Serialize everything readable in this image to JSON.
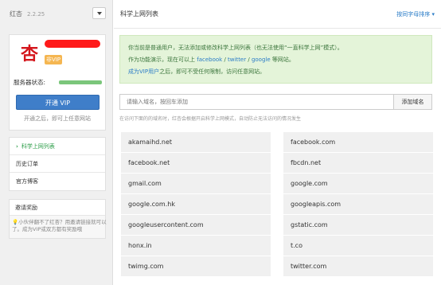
{
  "app": {
    "name": "红杏",
    "version": "2.2.25"
  },
  "user": {
    "avatar_char": "杏",
    "badge": "非VIP",
    "server_status_label": "服务器状态:",
    "server_status_level": 1.0,
    "vip_button": "开通 VIP",
    "vip_note": "开通之后，即可上任意网站"
  },
  "nav": {
    "items": [
      {
        "label": "科学上网列表",
        "active": true
      },
      {
        "label": "历史订单",
        "active": false
      },
      {
        "label": "官方博客",
        "active": false
      }
    ]
  },
  "invite": {
    "title": "邀请奖励",
    "text": "小伙伴翻不了红杏？用邀请链接就可以了。成为VIP或双方都有奖励哦"
  },
  "main": {
    "title": "科学上网列表",
    "sort_link": "按同字母排序 ▾",
    "notice": {
      "line1": "你当前是普通用户，无法添加或修改科学上网列表（也无法使用“一直科学上网”模式）。",
      "line2_pre": "作为功能演示，现在可以上",
      "line2_sites": [
        "facebook",
        "twitter",
        "google"
      ],
      "line2_post": "等网站。",
      "line3_link": "成为VIP用户",
      "line3_post": "之后，即可不受任何限制，访问任意网站。"
    },
    "search": {
      "placeholder": "请输入域名，按回车添加",
      "add_label": "添加域名"
    },
    "hint": "在访问下面的的域名时，红杏会根据开启科学上网模式，自动防止无法访问的情况发生"
  },
  "domains_left": [
    "akamaihd.net",
    "facebook.net",
    "gmail.com",
    "google.com.hk",
    "googleusercontent.com",
    "honx.in",
    "twimg.com"
  ],
  "domains_right": [
    "facebook.com",
    "fbcdn.net",
    "google.com",
    "googleapis.com",
    "gstatic.com",
    "t.co",
    "twitter.com"
  ]
}
